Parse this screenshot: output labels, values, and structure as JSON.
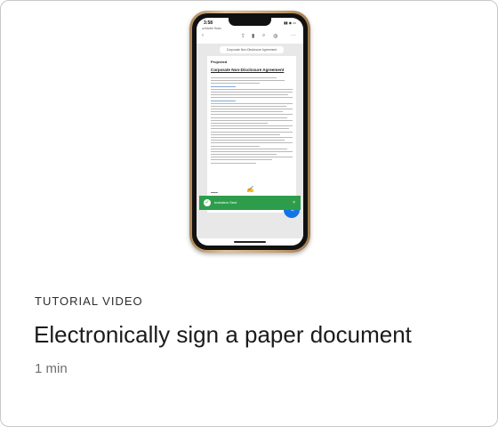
{
  "card": {
    "eyebrow": "TUTORIAL VIDEO",
    "title": "Electronically sign a paper document",
    "duration": "1 min"
  },
  "phone": {
    "time": "3:58",
    "back_app": "◂ Adobe Scan",
    "document_chip": "Corporate Non-Disclosure Agreement",
    "document_brand": "Projected",
    "document_title": "Corporate Non-Disclosure Agreement",
    "toast_message": "Invitation Sent",
    "toast_close": "×"
  },
  "colors": {
    "accent_blue": "#1473e6",
    "toast_green": "#2d9d4b",
    "phone_frame": "#d2b083"
  }
}
